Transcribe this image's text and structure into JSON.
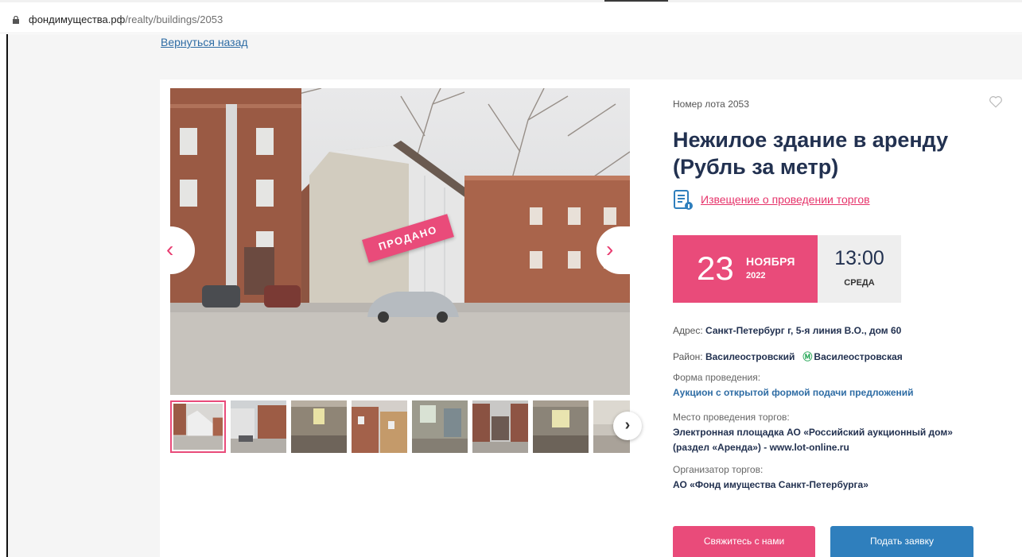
{
  "browser": {
    "url_domain": "фондимущества.рф",
    "url_path": "/realty/buildings/2053"
  },
  "nav": {
    "back_label": "Вернуться назад"
  },
  "gallery": {
    "badge": "ПРОДАНО",
    "prev_glyph": "‹",
    "next_glyph": "›",
    "thumbs_next_glyph": "›",
    "thumb_count": 8
  },
  "lot": {
    "number": "Номер лота 2053",
    "title": "Нежилое здание в аренду (Рубль за метр)",
    "notice_link": "Извещение о проведении торгов"
  },
  "auction_date": {
    "day": "23",
    "month": "НОЯБРЯ",
    "year": "2022",
    "time": "13:00",
    "weekday": "СРЕДА"
  },
  "details": {
    "address_label": "Адрес: ",
    "address_value": "Санкт-Петербург г, 5-я линия В.О., дом 60",
    "district_label": "Район: ",
    "district_value": "Василеостровский",
    "metro_value": "Василеостровская",
    "form_label": "Форма проведения:",
    "form_value": "Аукцион с открытой формой подачи предложений",
    "place_label": "Место проведения торгов:",
    "place_value": "Электронная площадка АО «Российский аукционный дом» (раздел «Аренда») - www.lot-online.ru",
    "organizer_label": "Организатор торгов:",
    "organizer_value": "АО «Фонд имущества Санкт-Петербурга»"
  },
  "buttons": {
    "contact": "Свяжитесь с нами",
    "apply": "Подать заявку"
  },
  "colors": {
    "accent_pink": "#e94b7a",
    "accent_blue": "#2f7fbd",
    "title_navy": "#223150",
    "metro_green": "#2ba95b"
  },
  "icons": [
    "lock-icon",
    "heart-icon",
    "document-icon",
    "metro-icon",
    "chevron-left-icon",
    "chevron-right-icon"
  ]
}
